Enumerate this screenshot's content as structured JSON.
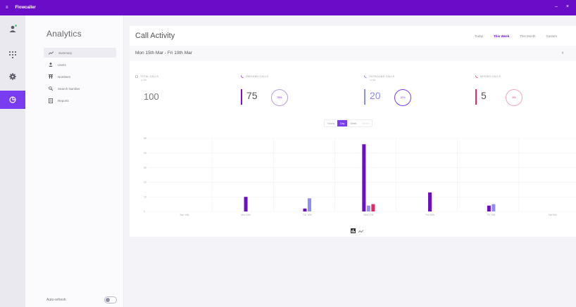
{
  "app": {
    "name": "Flowcaller"
  },
  "rail": {
    "items": [
      "profile",
      "dialpad",
      "settings",
      "analytics"
    ],
    "active": "analytics"
  },
  "nav": {
    "title": "Analytics",
    "items": [
      {
        "label": "Summary",
        "icon": "trend-icon",
        "active": true
      },
      {
        "label": "Users",
        "icon": "user-icon",
        "active": false
      },
      {
        "label": "Numbers",
        "icon": "numbers-icon",
        "active": false
      },
      {
        "label": "Search Number",
        "icon": "search-icon",
        "active": false
      },
      {
        "label": "Reports",
        "icon": "report-icon",
        "active": false
      }
    ],
    "autorefresh_label": "Auto-refresh",
    "autorefresh_on": false
  },
  "main": {
    "title": "Call Activity",
    "period_tabs": [
      "Today",
      "This Week",
      "This Month",
      "Custom"
    ],
    "active_period": "This Week",
    "date_range": "Mon 15th Mar - Fri 19th Mar",
    "stats": [
      {
        "label": "TOTAL CALLS",
        "sub": "vs 0%",
        "value": "100",
        "percent": "",
        "color": "#999999"
      },
      {
        "label": "INBOUND CALLS",
        "sub": "",
        "value": "75",
        "percent": "75%",
        "color": "#7a0fd6"
      },
      {
        "label": "OUTBOUND CALLS",
        "sub": "vs 0%",
        "value": "20",
        "percent": "20%",
        "color": "#6a6ad6"
      },
      {
        "label": "MISSED CALLS",
        "sub": "",
        "value": "5",
        "percent": "5%",
        "color": "#e8246b"
      }
    ],
    "granularity": [
      "Hourly",
      "Day",
      "Week",
      "Month"
    ],
    "active_granularity": "Day"
  },
  "chart_data": {
    "type": "bar",
    "categories": [
      "Sun 14th",
      "Mon 15th",
      "Tue 16th",
      "Wed 17th",
      "Thu 18th",
      "Fri 19th",
      "Sat 20th"
    ],
    "series": [
      {
        "values": [
          0,
          10,
          2,
          46,
          13,
          4,
          0
        ],
        "color": "#6b0fc4"
      },
      {
        "values": [
          0,
          0,
          9,
          4,
          0,
          5,
          0
        ],
        "color": "#8e8ef0"
      },
      {
        "values": [
          0,
          0,
          0,
          5,
          0,
          0,
          0
        ],
        "color": "#e8246b"
      }
    ],
    "yticks": [
      0,
      10,
      20,
      30,
      40,
      50
    ],
    "ylim": [
      0,
      50
    ],
    "grid": true
  }
}
